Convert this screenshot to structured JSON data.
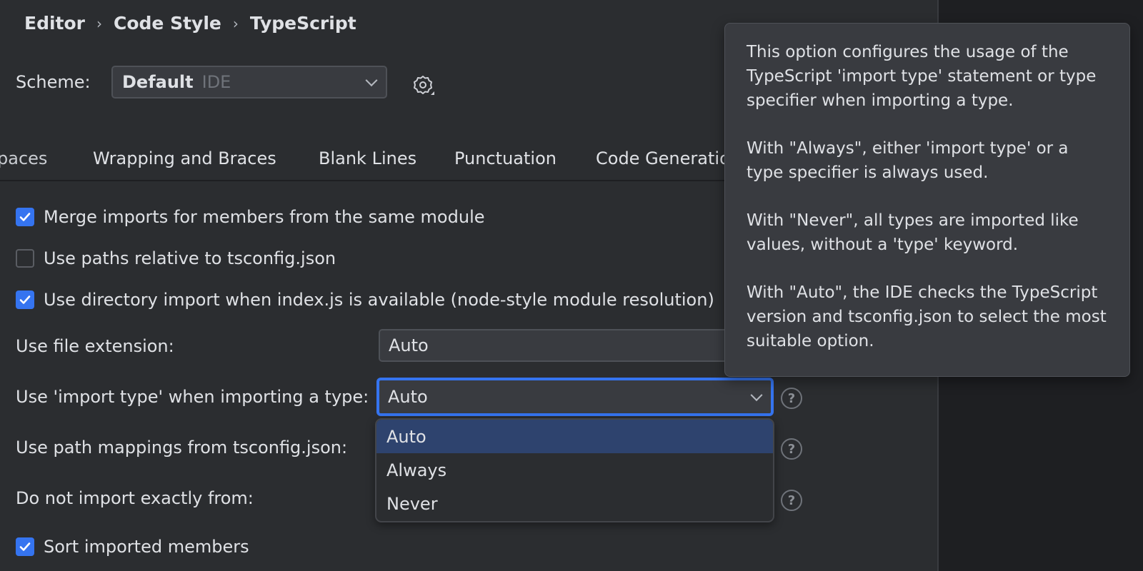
{
  "breadcrumb": [
    "Editor",
    "Code Style",
    "TypeScript"
  ],
  "breadcrumb_separator": "›",
  "scheme": {
    "label": "Scheme:",
    "value": "Default",
    "sub": "IDE"
  },
  "tabs": [
    "paces",
    "Wrapping and Braces",
    "Blank Lines",
    "Punctuation",
    "Code Generation"
  ],
  "checkboxes": [
    {
      "label": "Merge imports for members from the same module",
      "checked": true
    },
    {
      "label": "Use paths relative to tsconfig.json",
      "checked": false
    },
    {
      "label": "Use directory import when index.js is available (node-style module resolution)",
      "checked": true
    },
    {
      "label": "Sort imported members",
      "checked": true
    }
  ],
  "fields": {
    "file_extension": {
      "label": "Use file extension:",
      "value": "Auto"
    },
    "import_type": {
      "label": "Use 'import type' when importing a type:",
      "value": "Auto"
    },
    "path_mappings": {
      "label": "Use path mappings from tsconfig.json:"
    },
    "do_not_import": {
      "label": "Do not import exactly from:"
    }
  },
  "dropdown": {
    "options": [
      "Auto",
      "Always",
      "Never"
    ],
    "selected": "Auto"
  },
  "help_icon_glyph": "?",
  "tooltip": {
    "paragraphs": [
      "This option configures the usage of the TypeScript 'import type' statement or type specifier when importing a type.",
      "With \"Always\", either 'import type' or a type specifier is always used.",
      "With \"Never\", all types are imported like values, without a 'type' keyword.",
      "With \"Auto\", the IDE checks the TypeScript version and tsconfig.json to select the most suitable option."
    ]
  },
  "colors": {
    "accent": "#3574f0",
    "selection": "#2e436e",
    "background": "#2b2d30",
    "tooltip_bg": "#393b40"
  }
}
